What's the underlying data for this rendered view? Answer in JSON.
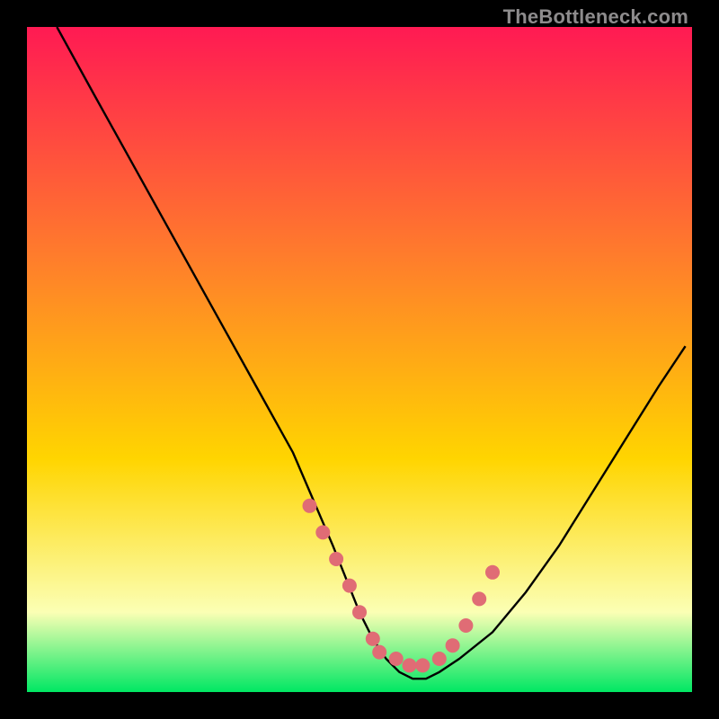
{
  "watermark": {
    "text": "TheBottleneck.com"
  },
  "chart_data": {
    "type": "line",
    "title": "",
    "xlabel": "",
    "ylabel": "",
    "xlim": [
      0,
      100
    ],
    "ylim": [
      0,
      100
    ],
    "grid": false,
    "legend": false,
    "background_gradient": {
      "top_color": "#ff1a53",
      "mid_color": "#ffd500",
      "bottom_color": "#00e763",
      "bottom_band_color": "#fbffb4"
    },
    "curve_color": "#000000",
    "series": [
      {
        "name": "bottleneck-curve",
        "x": [
          4.5,
          10,
          15,
          20,
          25,
          30,
          35,
          40,
          43,
          46,
          48,
          50,
          52,
          54,
          56,
          58,
          60,
          62,
          65,
          70,
          75,
          80,
          85,
          90,
          95,
          99
        ],
        "y": [
          100,
          90,
          81,
          72,
          63,
          54,
          45,
          36,
          29,
          22,
          17,
          12,
          8,
          5,
          3,
          2,
          2,
          3,
          5,
          9,
          15,
          22,
          30,
          38,
          46,
          52
        ]
      }
    ],
    "marker_points": {
      "color": "#e06c75",
      "radius": 8,
      "x": [
        42.5,
        44.5,
        46.5,
        48.5,
        50,
        52,
        53,
        55.5,
        57.5,
        59.5,
        62,
        64,
        66,
        68,
        70
      ],
      "y": [
        28,
        24,
        20,
        16,
        12,
        8,
        6,
        5,
        4,
        4,
        5,
        7,
        10,
        14,
        18
      ]
    }
  }
}
